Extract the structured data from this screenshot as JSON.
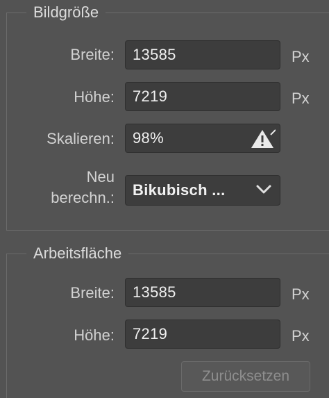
{
  "image_size": {
    "title": "Bildgröße",
    "width_label": "Breite:",
    "width_value": "13585",
    "width_unit": "Px",
    "height_label": "Höhe:",
    "height_value": "7219",
    "height_unit": "Px",
    "scale_label": "Skalieren:",
    "scale_value": "98%",
    "resample_label_line1": "Neu",
    "resample_label_line2": "berechn.:",
    "resample_value": "Bikubisch ..."
  },
  "canvas": {
    "title": "Arbeitsfläche",
    "width_label": "Breite:",
    "width_value": "13585",
    "width_unit": "Px",
    "height_label": "Höhe:",
    "height_value": "7219",
    "height_unit": "Px"
  },
  "reset_label": "Zurücksetzen",
  "icons": {
    "scale_warning": "warning-icon",
    "resample_dropdown": "chevron-down-icon"
  },
  "colors": {
    "panel_bg": "#535353",
    "field_bg": "#3d3d3d",
    "text": "#d2d2d2",
    "value_text": "#f0f0f0"
  }
}
